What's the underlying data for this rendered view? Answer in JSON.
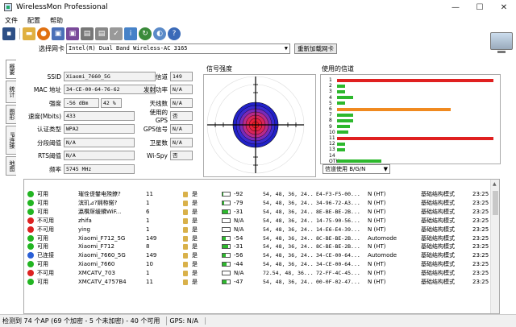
{
  "window": {
    "title": "WirelessMon Professional",
    "minimize": "—",
    "maximize": "☐",
    "close": "✕"
  },
  "menu": [
    "文件",
    "配置",
    "帮助"
  ],
  "adapter": {
    "label": "选择网卡",
    "value": "Intel(R) Dual Band Wireless-AC 3165",
    "reload": "重新加载网卡"
  },
  "side_tabs": [
    "概要",
    "统计",
    "图形",
    "IP连接",
    "地图"
  ],
  "info": {
    "ssid_label": "SSID",
    "ssid": "Xiaomi_7660_5G",
    "channel_label": "信道",
    "channel": "149",
    "mac_label": "MAC 地址",
    "mac": "34-CE-00-64-76-62",
    "txpower_label": "发射功率",
    "txpower": "N/A",
    "strength_label": "强度",
    "strength_dbm": "-56 dBm",
    "strength_pct": "42 %",
    "antennas_label": "天线数",
    "antennas": "N/A",
    "speed_label": "速度(Mbits)",
    "speed": "433",
    "gps_label": "使用的GPS",
    "gps": "否",
    "auth_label": "认证类型",
    "auth": "WPA2",
    "gps_signal_label": "GPS信号",
    "gps_signal": "N/A",
    "frag_label": "分段阈值",
    "frag": "N/A",
    "sat_label": "卫星数",
    "sat": "N/A",
    "rts_label": "RTS阈值",
    "rts": "N/A",
    "wispy_label": "Wi-Spy",
    "wispy": "否",
    "freq_label": "频率",
    "freq": "5745 MHz"
  },
  "radar": {
    "title": "信号强度"
  },
  "channels": {
    "title": "使用的信道",
    "labels": [
      "1",
      "2",
      "3",
      "4",
      "5",
      "6",
      "7",
      "8",
      "9",
      "10",
      "11",
      "12",
      "13",
      "14",
      "OTH"
    ],
    "select": "信道使用 B/G/N",
    "bars": [
      {
        "ch": "1",
        "segments": [
          {
            "len": 0.98,
            "color": "#e02020"
          }
        ]
      },
      {
        "ch": "2",
        "segments": [
          {
            "len": 0.05,
            "color": "#2db82d"
          }
        ]
      },
      {
        "ch": "3",
        "segments": [
          {
            "len": 0.05,
            "color": "#2db82d"
          }
        ]
      },
      {
        "ch": "4",
        "segments": [
          {
            "len": 0.1,
            "color": "#2db82d"
          }
        ]
      },
      {
        "ch": "5",
        "segments": [
          {
            "len": 0.05,
            "color": "#2db82d"
          }
        ]
      },
      {
        "ch": "6",
        "segments": [
          {
            "len": 0.71,
            "color": "#f08a20"
          }
        ]
      },
      {
        "ch": "7",
        "segments": [
          {
            "len": 0.1,
            "color": "#2db82d"
          }
        ]
      },
      {
        "ch": "8",
        "segments": [
          {
            "len": 0.1,
            "color": "#2db82d"
          }
        ]
      },
      {
        "ch": "9",
        "segments": [
          {
            "len": 0.08,
            "color": "#2db82d"
          }
        ]
      },
      {
        "ch": "10",
        "segments": [
          {
            "len": 0.07,
            "color": "#2db82d"
          }
        ]
      },
      {
        "ch": "11",
        "segments": [
          {
            "len": 0.98,
            "color": "#e02020"
          }
        ]
      },
      {
        "ch": "12",
        "segments": [
          {
            "len": 0.05,
            "color": "#2db82d"
          }
        ]
      },
      {
        "ch": "13",
        "segments": [
          {
            "len": 0.05,
            "color": "#2db82d"
          }
        ]
      },
      {
        "ch": "14",
        "segments": []
      },
      {
        "ch": "OTH",
        "segments": [
          {
            "len": 0.28,
            "color": "#2db82d"
          }
        ]
      }
    ]
  },
  "ap_list": [
    {
      "status": "可用",
      "color": "#22b522",
      "ssid": "璀佺偍鐢电殑鐐?",
      "ch": "11",
      "sec": "是",
      "sig": "-92",
      "fill": 0.1,
      "rates": "54, 48, 36, 24...",
      "mac": "E4-F3-F5-00...",
      "mode": "N (HT)",
      "type": "基础结构模式",
      "time": "23:25"
    },
    {
      "status": "可用",
      "color": "#22b522",
      "ssid": "滨玑⊿?娴栫鍩?",
      "ch": "1",
      "sec": "是",
      "sig": "-79",
      "fill": 0.2,
      "rates": "54, 48, 36, 24...",
      "mac": "34-96-72-A3...",
      "mode": "N (HT)",
      "type": "基础结构模式",
      "time": "23:25"
    },
    {
      "status": "可用",
      "color": "#22b522",
      "ssid": "瀛欑厛缓鐨WiF...",
      "ch": "6",
      "sec": "是",
      "sig": "-31",
      "fill": 0.8,
      "rates": "54, 48, 36, 24...",
      "mac": "8E-BE-BE-2B...",
      "mode": "N (HT)",
      "type": "基础结构模式",
      "time": "23:25"
    },
    {
      "status": "不可用",
      "color": "#d22",
      "ssid": "zhifa",
      "ch": "1",
      "sec": "是",
      "sig": "N/A",
      "fill": 0,
      "rates": "54, 48, 36, 24...",
      "mac": "14-75-90-56...",
      "mode": "N (HT)",
      "type": "基础结构模式",
      "time": "23:25"
    },
    {
      "status": "不可用",
      "color": "#d22",
      "ssid": "ying",
      "ch": "1",
      "sec": "是",
      "sig": "N/A",
      "fill": 0,
      "rates": "54, 48, 36, 24...",
      "mac": "14-E6-E4-39...",
      "mode": "N (HT)",
      "type": "基础结构模式",
      "time": "23:25"
    },
    {
      "status": "可用",
      "color": "#22b522",
      "ssid": "Xiaomi_F712_5G",
      "ch": "149",
      "sec": "是",
      "sig": "-54",
      "fill": 0.45,
      "rates": "54, 48, 36, 24...",
      "mac": "8C-BE-BE-2B...",
      "mode": "Automode",
      "type": "基础结构模式",
      "time": "23:25"
    },
    {
      "status": "可用",
      "color": "#22b522",
      "ssid": "Xiaomi_F712",
      "ch": "8",
      "sec": "是",
      "sig": "-31",
      "fill": 0.8,
      "rates": "54, 48, 36, 24...",
      "mac": "8C-BE-BE-2B...",
      "mode": "N (HT)",
      "type": "基础结构模式",
      "time": "23:25"
    },
    {
      "status": "已连接",
      "color": "#2a5fd6",
      "ssid": "Xiaomi_7660_5G",
      "ch": "149",
      "sec": "是",
      "sig": "-56",
      "fill": 0.42,
      "rates": "54, 48, 36, 24...",
      "mac": "34-CE-00-64...",
      "mode": "Automode",
      "type": "基础结构模式",
      "time": "23:25"
    },
    {
      "status": "可用",
      "color": "#22b522",
      "ssid": "Xiaomi_7660",
      "ch": "10",
      "sec": "是",
      "sig": "-44",
      "fill": 0.6,
      "rates": "54, 48, 36, 24...",
      "mac": "34-CE-00-64...",
      "mode": "N (HT)",
      "type": "基础结构模式",
      "time": "23:25"
    },
    {
      "status": "不可用",
      "color": "#d22",
      "ssid": "XMCATV_703",
      "ch": "1",
      "sec": "是",
      "sig": "N/A",
      "fill": 0,
      "rates": "72.54, 48, 36...",
      "mac": "72-FF-4C-45...",
      "mode": "N (HT)",
      "type": "基础结构模式",
      "time": "23:25"
    },
    {
      "status": "可用",
      "color": "#22b522",
      "ssid": "XMCATV_4757B4",
      "ch": "11",
      "sec": "是",
      "sig": "-47",
      "fill": 0.55,
      "rates": "54, 48, 36, 24...",
      "mac": "00-0F-02-47...",
      "mode": "N (HT)",
      "type": "基础结构模式",
      "time": "23:25"
    }
  ],
  "status": {
    "ap_count": "检测到 74 个AP (69 个加密 - 5 个未加密) - 40 个可用",
    "gps": "GPS: N/A"
  }
}
